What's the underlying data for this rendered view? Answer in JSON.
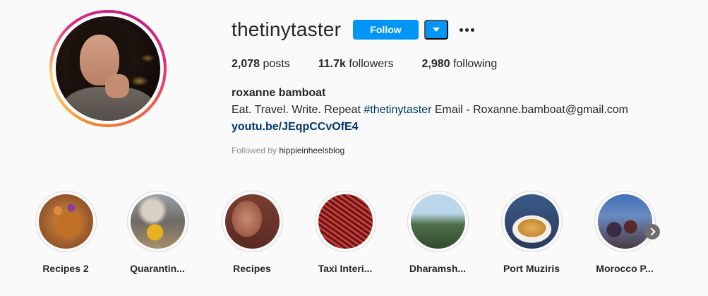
{
  "profile": {
    "username": "thetinytaster",
    "follow_label": "Follow",
    "more_icon": "more-horizontal-icon",
    "dropdown_icon": "caret-down-icon",
    "full_name": "roxanne bamboat",
    "bio_text": "Eat. Travel. Write. Repeat ",
    "bio_hashtag": "#thetinytaster",
    "bio_email": " Email - Roxanne.bamboat@gmail.com",
    "link": "youtu.be/JEqpCCvOfE4",
    "followed_by_prefix": "Followed by ",
    "followed_by_user": "hippieinheelsblog"
  },
  "stats": {
    "posts_count": "2,078",
    "posts_label": " posts",
    "followers_count": "11.7k",
    "followers_label": " followers",
    "following_count": "2,980",
    "following_label": " following"
  },
  "highlights": [
    {
      "label": "Recipes 2"
    },
    {
      "label": "Quarantin..."
    },
    {
      "label": "Recipes"
    },
    {
      "label": "Taxi Interi..."
    },
    {
      "label": "Dharamsh..."
    },
    {
      "label": "Port Muziris"
    },
    {
      "label": "Morocco P..."
    }
  ],
  "colors": {
    "accent": "#0095f6",
    "link": "#00376b",
    "text": "#262626",
    "muted": "#8e8e8e"
  }
}
